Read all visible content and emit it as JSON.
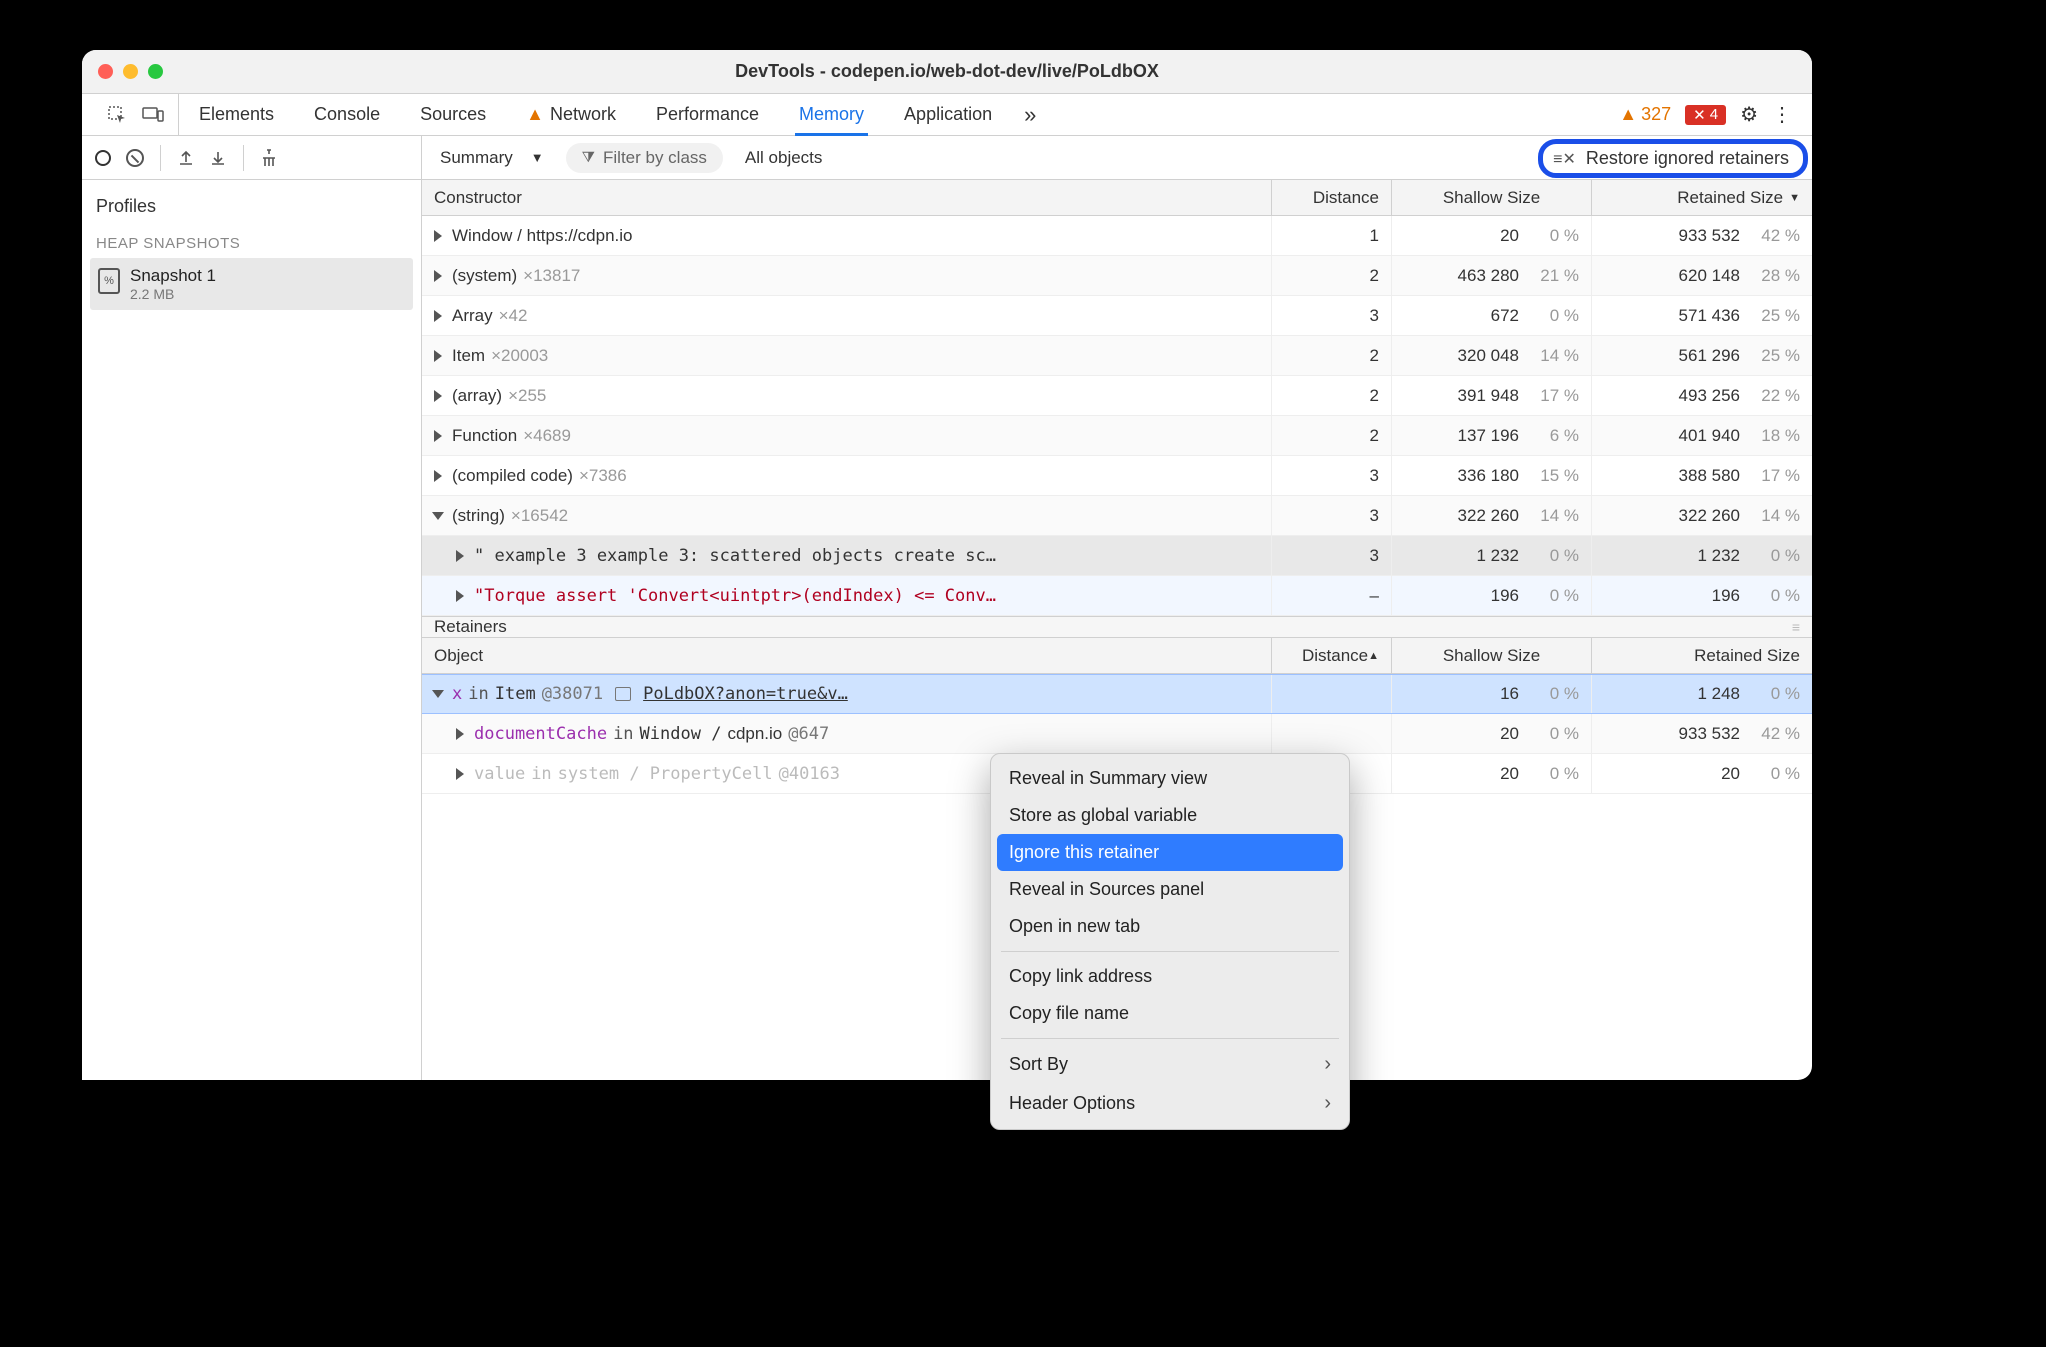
{
  "title": "DevTools - codepen.io/web-dot-dev/live/PoLdbOX",
  "tabs": [
    "Elements",
    "Console",
    "Sources",
    "Network",
    "Performance",
    "Memory",
    "Application"
  ],
  "active_tab": "Memory",
  "warn_tab": "Network",
  "overflow_glyph": "»",
  "status": {
    "warn_count": "327",
    "err_count": "4"
  },
  "sidebar": {
    "profiles_label": "Profiles",
    "heap_label": "HEAP SNAPSHOTS",
    "snapshot_name": "Snapshot 1",
    "snapshot_size": "2.2 MB"
  },
  "main_toolbar": {
    "view": "Summary",
    "filter_placeholder": "Filter by class",
    "scope": "All objects",
    "restore_label": "Restore ignored retainers"
  },
  "columns": {
    "constructor": "Constructor",
    "distance": "Distance",
    "shallow": "Shallow Size",
    "retained": "Retained Size"
  },
  "rows": [
    {
      "name": "Window / https://cdpn.io",
      "count": "",
      "dist": "1",
      "sh": "20",
      "shp": "0 %",
      "rt": "933 532",
      "rtp": "42 %"
    },
    {
      "name": "(system)",
      "count": "×13817",
      "dist": "2",
      "sh": "463 280",
      "shp": "21 %",
      "rt": "620 148",
      "rtp": "28 %"
    },
    {
      "name": "Array",
      "count": "×42",
      "dist": "3",
      "sh": "672",
      "shp": "0 %",
      "rt": "571 436",
      "rtp": "25 %"
    },
    {
      "name": "Item",
      "count": "×20003",
      "dist": "2",
      "sh": "320 048",
      "shp": "14 %",
      "rt": "561 296",
      "rtp": "25 %"
    },
    {
      "name": "(array)",
      "count": "×255",
      "dist": "2",
      "sh": "391 948",
      "shp": "17 %",
      "rt": "493 256",
      "rtp": "22 %"
    },
    {
      "name": "Function",
      "count": "×4689",
      "dist": "2",
      "sh": "137 196",
      "shp": "6 %",
      "rt": "401 940",
      "rtp": "18 %"
    },
    {
      "name": "(compiled code)",
      "count": "×7386",
      "dist": "3",
      "sh": "336 180",
      "shp": "15 %",
      "rt": "388 580",
      "rtp": "17 %"
    },
    {
      "name": "(string)",
      "count": "×16542",
      "dist": "3",
      "sh": "322 260",
      "shp": "14 %",
      "rt": "322 260",
      "rtp": "14 %",
      "open": true
    },
    {
      "child": true,
      "text": "\" example 3 example 3: scattered objects create sc…",
      "dist": "3",
      "sh": "1 232",
      "shp": "0 %",
      "rt": "1 232",
      "rtp": "0 %",
      "hl": true
    },
    {
      "child": true,
      "str": true,
      "text": "\"Torque assert 'Convert<uintptr>(endIndex) <= Conv…",
      "dist": "–",
      "sh": "196",
      "shp": "0 %",
      "rt": "196",
      "rtp": "0 %",
      "sel": true
    }
  ],
  "retainers_label": "Retainers",
  "retain_columns": {
    "object": "Object",
    "distance": "Distance",
    "shallow": "Shallow Size",
    "retained": "Retained Size"
  },
  "retain_rows": [
    {
      "sel": true,
      "open": true,
      "prop": "x",
      "in": "in",
      "cls": "Item",
      "id": "@38071",
      "link": "PoLdbOX?anon=true&v…",
      "dist": "",
      "sh": "16",
      "shp": "0 %",
      "rt": "1 248",
      "rtp": "0 %"
    },
    {
      "prop": "documentCache",
      "in": "in",
      "cls": "Window / ",
      "host": "cdpn.io",
      "id": "@647",
      "dist": "",
      "sh": "20",
      "shp": "0 %",
      "rt": "933 532",
      "rtp": "42 %"
    },
    {
      "dim": true,
      "prop": "value",
      "in": "in",
      "cls": "system / PropertyCell",
      "id": "@40163",
      "dist": "",
      "sh": "20",
      "shp": "0 %",
      "rt": "20",
      "rtp": "0 %"
    }
  ],
  "ctx": {
    "items": [
      "Reveal in Summary view",
      "Store as global variable",
      "Ignore this retainer",
      "Reveal in Sources panel",
      "Open in new tab"
    ],
    "items2": [
      "Copy link address",
      "Copy file name"
    ],
    "items3": [
      "Sort By",
      "Header Options"
    ],
    "highlight_index": 2
  }
}
